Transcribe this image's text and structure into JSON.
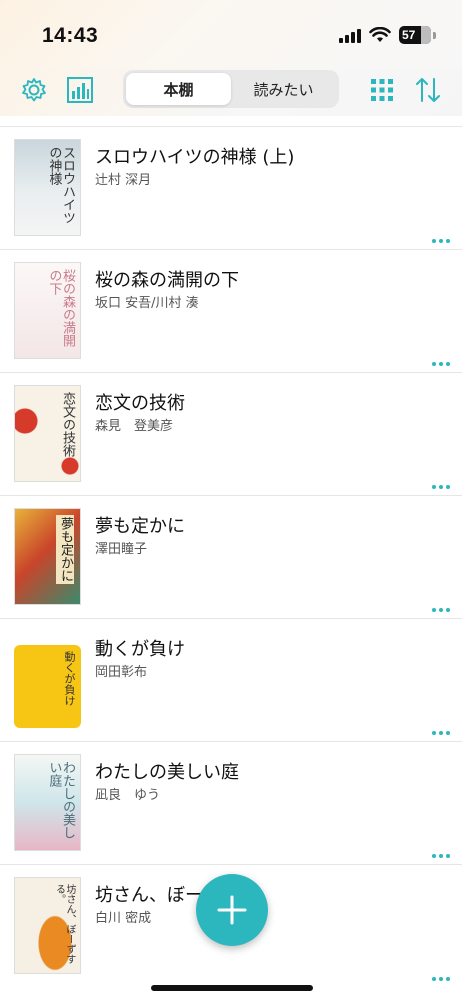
{
  "status": {
    "time": "14:43",
    "battery": "57"
  },
  "toolbar": {
    "tabs": [
      {
        "label": "本棚",
        "active": true
      },
      {
        "label": "読みたい",
        "active": false
      }
    ],
    "accent": "#2bb7bd"
  },
  "books": [
    {
      "title": "スロウハイツの神様 (上)",
      "author": "辻村 深月",
      "cover_text": "スロウハイツの神様",
      "cover_bg": "#dfe6ea"
    },
    {
      "title": "桜の森の満開の下",
      "author": "坂口 安吾/川村 湊",
      "cover_text": "桜の森の満開の下",
      "cover_bg": "#f4efee"
    },
    {
      "title": "恋文の技術",
      "author": "森見　登美彦",
      "cover_text": "恋文の技術",
      "cover_bg": "#f6efe3"
    },
    {
      "title": "夢も定かに",
      "author": "澤田瞳子",
      "cover_text": "夢も定かに",
      "cover_bg": "#e8b23b"
    },
    {
      "title": "動くが負け",
      "author": "岡田彰布",
      "cover_text": "動くが負け",
      "cover_bg": "#f6c416"
    },
    {
      "title": "わたしの美しい庭",
      "author": "凪良　ゆう",
      "cover_text": "わたしの美しい庭",
      "cover_bg": "#cfe8ea"
    },
    {
      "title": "坊さん、ぼーずする。",
      "author": "白川 密成",
      "cover_text": "坊さん、ぼーずする。",
      "cover_bg": "#f5efe2"
    }
  ],
  "fab": {
    "icon": "plus-icon"
  }
}
